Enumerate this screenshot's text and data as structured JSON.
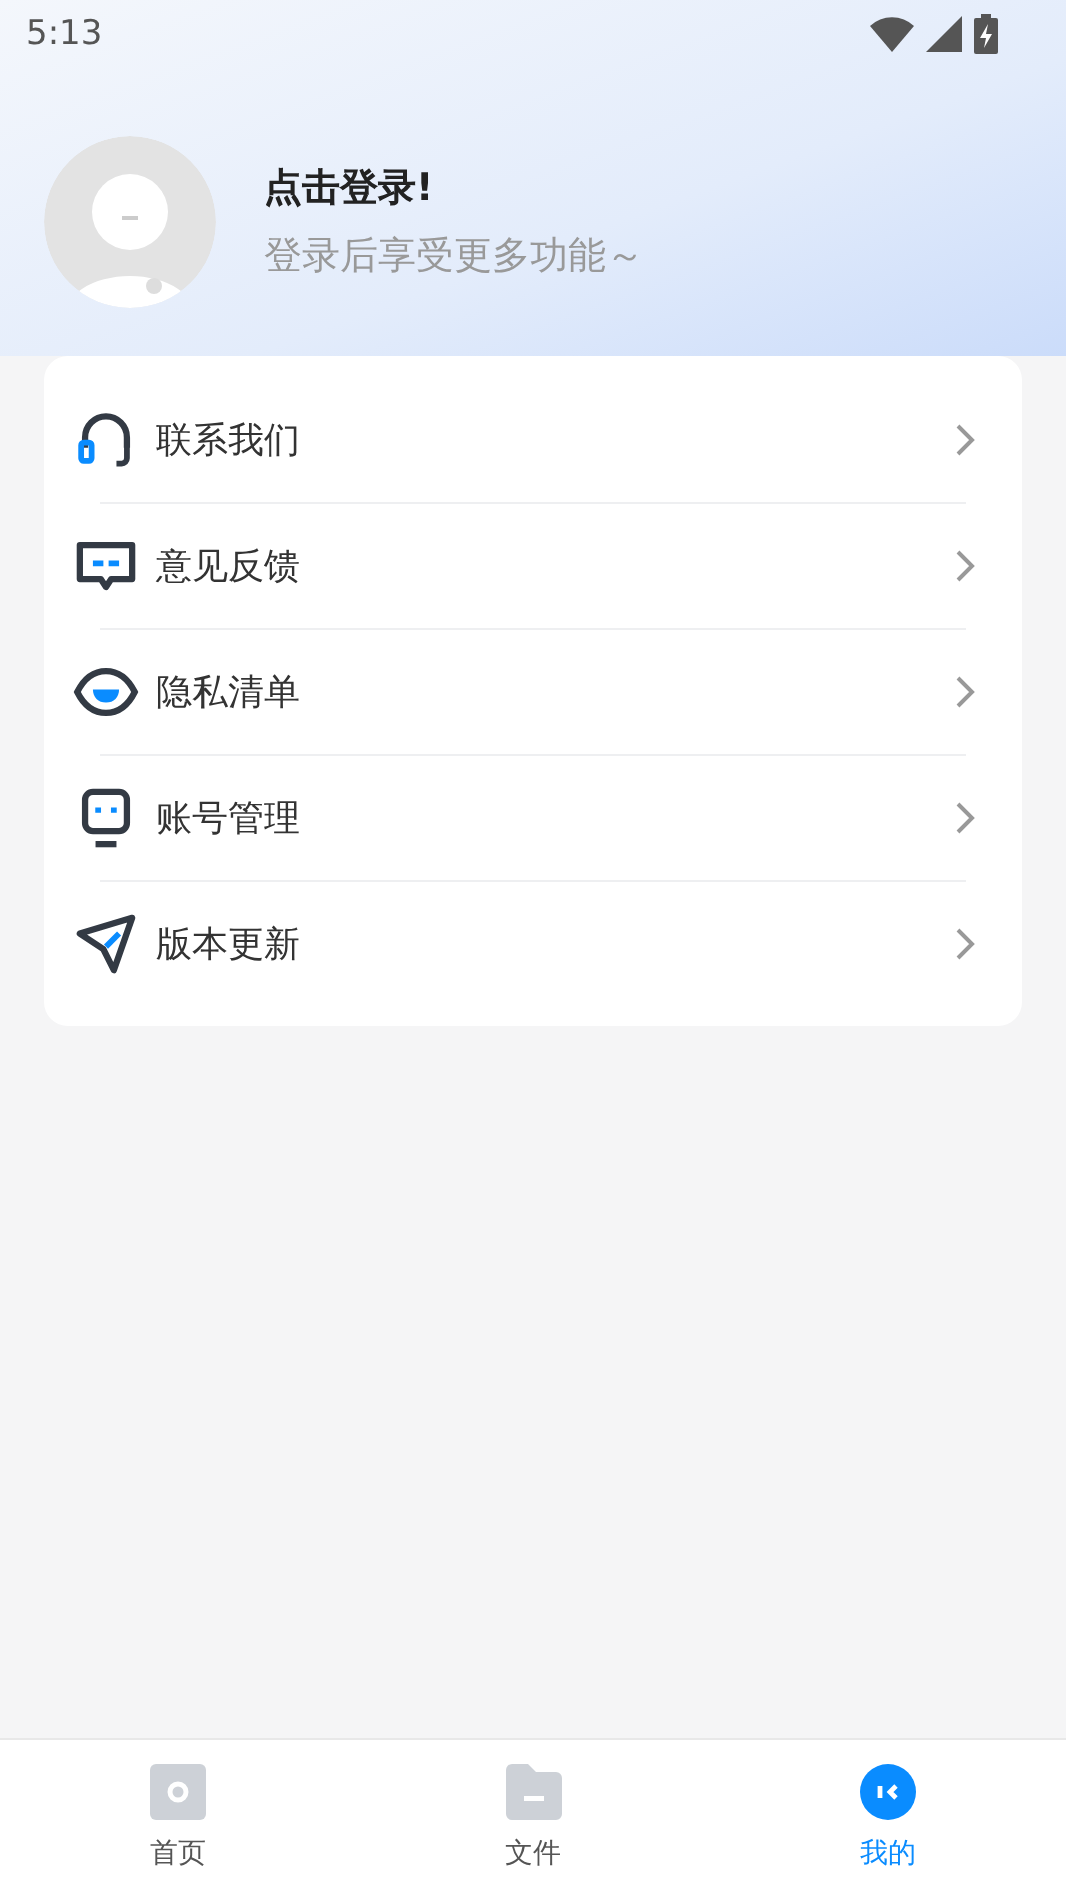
{
  "status_bar": {
    "time": "5:13"
  },
  "profile": {
    "title": "点击登录!",
    "subtitle": "登录后享受更多功能～"
  },
  "menu": [
    {
      "label": "联系我们"
    },
    {
      "label": "意见反馈"
    },
    {
      "label": "隐私清单"
    },
    {
      "label": "账号管理"
    },
    {
      "label": "版本更新"
    }
  ],
  "tabs": [
    {
      "label": "首页",
      "selected": false
    },
    {
      "label": "文件",
      "selected": false
    },
    {
      "label": "我的",
      "selected": true
    }
  ]
}
